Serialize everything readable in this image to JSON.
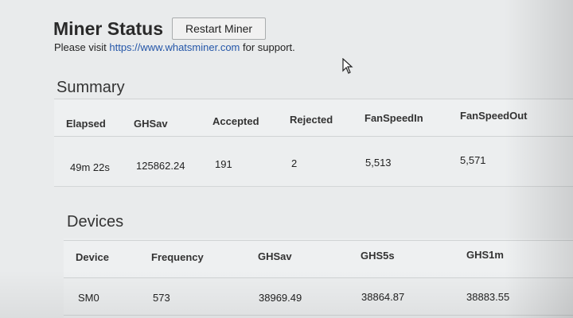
{
  "header": {
    "title": "Miner Status",
    "restart_label": "Restart Miner",
    "support_prefix": "Please visit ",
    "support_link": "https://www.whatsminer.com",
    "support_suffix": " for support."
  },
  "summary": {
    "heading": "Summary",
    "columns": [
      "Elapsed",
      "GHSav",
      "Accepted",
      "Rejected",
      "FanSpeedIn",
      "FanSpeedOut"
    ],
    "rows": [
      [
        "49m 22s",
        "125862.24",
        "191",
        "2",
        "5,513",
        "5,571"
      ]
    ]
  },
  "devices": {
    "heading": "Devices",
    "columns": [
      "Device",
      "Frequency",
      "GHSav",
      "GHS5s",
      "GHS1m"
    ],
    "rows": [
      [
        "SM0",
        "573",
        "38969.49",
        "38864.87",
        "38883.55"
      ]
    ]
  }
}
